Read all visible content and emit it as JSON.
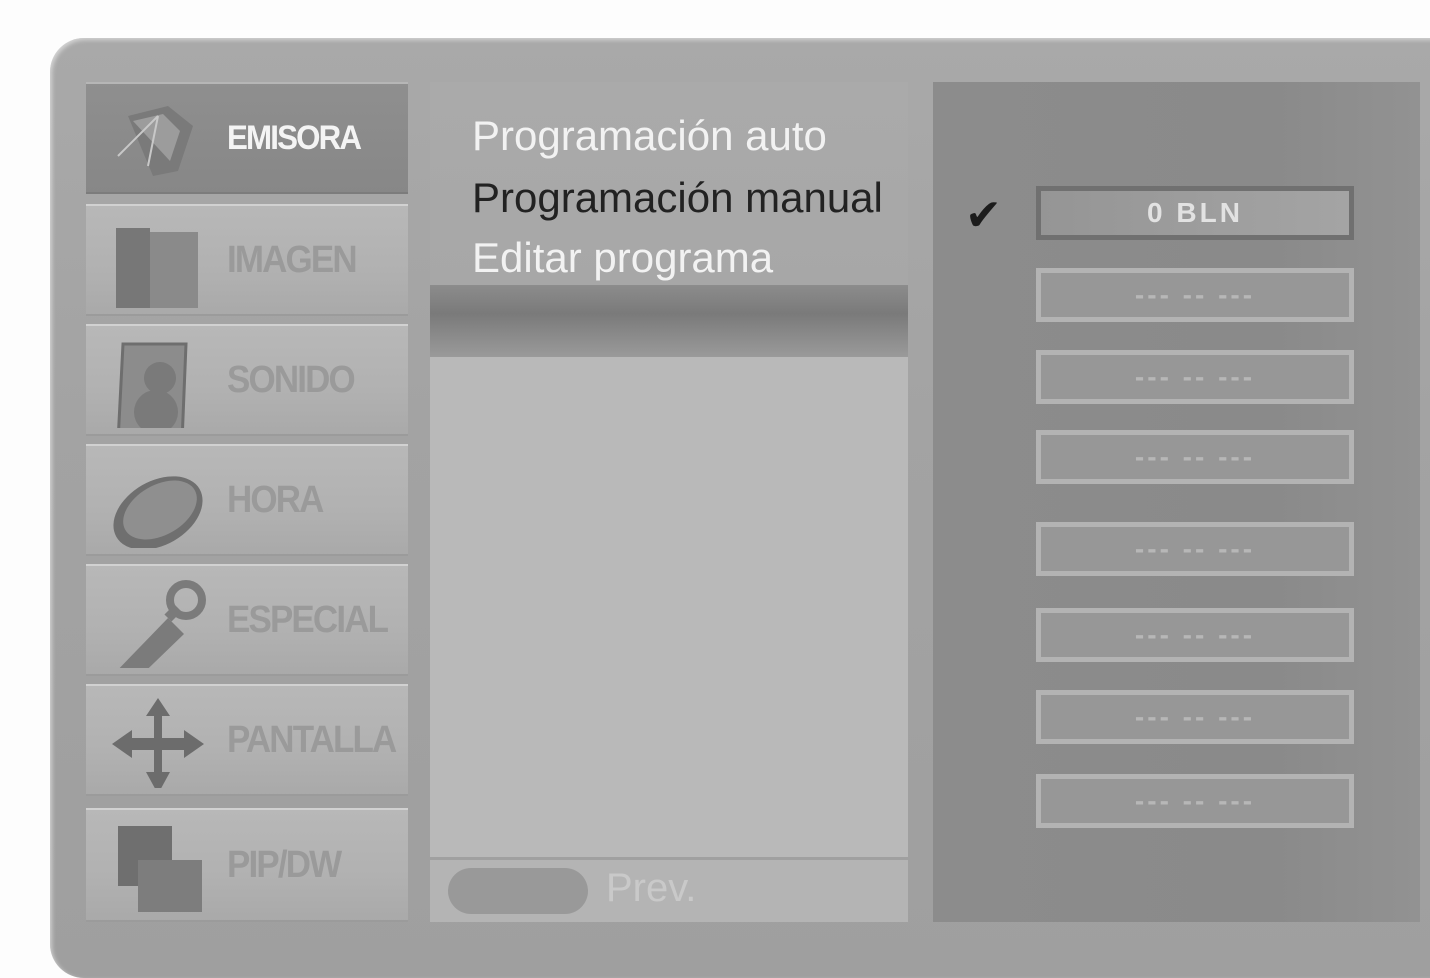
{
  "menu": {
    "categories": [
      {
        "label": "EMISORA",
        "icon": "antenna-icon",
        "active": true
      },
      {
        "label": "IMAGEN",
        "icon": "picture-icon",
        "active": false
      },
      {
        "label": "SONIDO",
        "icon": "speaker-icon",
        "active": false
      },
      {
        "label": "HORA",
        "icon": "clock-icon",
        "active": false
      },
      {
        "label": "ESPECIAL",
        "icon": "wrench-icon",
        "active": false
      },
      {
        "label": "PANTALLA",
        "icon": "move-arrows-icon",
        "active": false
      },
      {
        "label": "PIP/DW",
        "icon": "pip-icon",
        "active": false
      }
    ]
  },
  "submenu": {
    "items": [
      {
        "label": "Programación auto",
        "selected": false
      },
      {
        "label": "Programación manual",
        "selected": true
      },
      {
        "label": "Editar programa",
        "selected": false
      }
    ]
  },
  "preview": {
    "label": "Prev."
  },
  "programs": {
    "check_icon": "check-icon",
    "check_symbol": "✔",
    "items": [
      {
        "text": "0 BLN",
        "active": true
      },
      {
        "text": "--- -- ---",
        "active": false
      },
      {
        "text": "--- -- ---",
        "active": false
      },
      {
        "text": "--- -- ---",
        "active": false
      },
      {
        "text": "--- -- ---",
        "active": false
      },
      {
        "text": "--- -- ---",
        "active": false
      },
      {
        "text": "--- -- ---",
        "active": false
      },
      {
        "text": "--- -- ---",
        "active": false
      }
    ]
  },
  "colors": {
    "frame": "#a5a5a5",
    "active_category": "#8a8a8a",
    "selected_text": "#222222",
    "panel": "#8c8c8c"
  }
}
